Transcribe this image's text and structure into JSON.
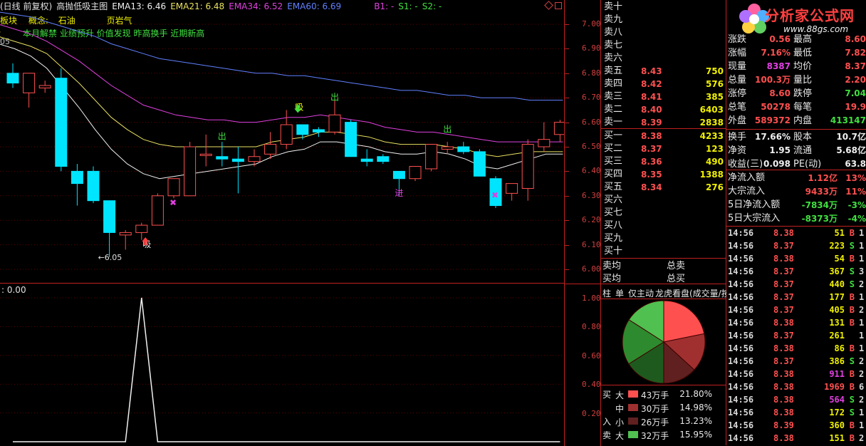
{
  "header": {
    "chart_mode": "(日线 前复权)",
    "indicator_name": "高抛低吸主图",
    "ema13": "EMA13: 6.46",
    "ema21": "EMA21: 6.48",
    "ema34": "EMA34: 6.52",
    "ema60": "EMA60: 6.69",
    "b1": "B1: -",
    "s1": "S1: -",
    "s2": "S2: -"
  },
  "concept": {
    "sector_label": "板块",
    "concept_label": "概念:",
    "concept_value": "石油",
    "extra": "页岩气",
    "tags": "本月解禁 业绩预升 价值发现 昨高换手 近期新高",
    "left_clip": "05"
  },
  "sub_chart": {
    "title": ": 0.00"
  },
  "price_axis": [
    "7.00",
    "6.90",
    "6.80",
    "6.70",
    "6.60",
    "6.50",
    "6.40",
    "6.30",
    "6.20",
    "6.10",
    "6.00"
  ],
  "sub_axis": [
    "1.00",
    "0.80",
    "0.60",
    "0.40",
    "0.20"
  ],
  "chart_data": {
    "type": "candlestick",
    "ylim": [
      5.95,
      7.05
    ],
    "candles": [
      {
        "o": 6.8,
        "h": 6.84,
        "l": 6.74,
        "c": 6.76
      },
      {
        "o": 6.72,
        "h": 6.78,
        "l": 6.66,
        "c": 6.8
      },
      {
        "o": 6.74,
        "h": 6.77,
        "l": 6.72,
        "c": 6.75
      },
      {
        "o": 6.78,
        "h": 6.82,
        "l": 6.4,
        "c": 6.42
      },
      {
        "o": 6.4,
        "h": 6.43,
        "l": 6.26,
        "c": 6.35
      },
      {
        "o": 6.4,
        "h": 6.42,
        "l": 6.27,
        "c": 6.28
      },
      {
        "o": 6.28,
        "h": 6.28,
        "l": 6.05,
        "c": 6.15
      },
      {
        "o": 6.14,
        "h": 6.16,
        "l": 6.08,
        "c": 6.15
      },
      {
        "o": 6.15,
        "h": 6.19,
        "l": 6.12,
        "c": 6.18
      },
      {
        "o": 6.18,
        "h": 6.31,
        "l": 6.18,
        "c": 6.3
      },
      {
        "o": 6.3,
        "h": 6.37,
        "l": 6.29,
        "c": 6.37
      },
      {
        "o": 6.3,
        "h": 6.52,
        "l": 6.3,
        "c": 6.5
      },
      {
        "o": 6.47,
        "h": 6.55,
        "l": 6.42,
        "c": 6.47
      },
      {
        "o": 6.46,
        "h": 6.52,
        "l": 6.42,
        "c": 6.45
      },
      {
        "o": 6.45,
        "h": 6.5,
        "l": 6.31,
        "c": 6.44
      },
      {
        "o": 6.44,
        "h": 6.49,
        "l": 6.42,
        "c": 6.46
      },
      {
        "o": 6.47,
        "h": 6.56,
        "l": 6.45,
        "c": 6.51
      },
      {
        "o": 6.51,
        "h": 6.65,
        "l": 6.49,
        "c": 6.59
      },
      {
        "o": 6.59,
        "h": 6.59,
        "l": 6.53,
        "c": 6.55
      },
      {
        "o": 6.57,
        "h": 6.58,
        "l": 6.54,
        "c": 6.56
      },
      {
        "o": 6.56,
        "h": 6.72,
        "l": 6.55,
        "c": 6.63
      },
      {
        "o": 6.6,
        "h": 6.61,
        "l": 6.46,
        "c": 6.46
      },
      {
        "o": 6.45,
        "h": 6.49,
        "l": 6.42,
        "c": 6.44
      },
      {
        "o": 6.46,
        "h": 6.47,
        "l": 6.43,
        "c": 6.44
      },
      {
        "o": 6.4,
        "h": 6.4,
        "l": 6.3,
        "c": 6.37
      },
      {
        "o": 6.37,
        "h": 6.42,
        "l": 6.36,
        "c": 6.42
      },
      {
        "o": 6.41,
        "h": 6.51,
        "l": 6.4,
        "c": 6.51
      },
      {
        "o": 6.49,
        "h": 6.52,
        "l": 6.47,
        "c": 6.5
      },
      {
        "o": 6.5,
        "h": 6.52,
        "l": 6.47,
        "c": 6.48
      },
      {
        "o": 6.48,
        "h": 6.49,
        "l": 6.38,
        "c": 6.38
      },
      {
        "o": 6.37,
        "h": 6.38,
        "l": 6.25,
        "c": 6.26
      },
      {
        "o": 6.31,
        "h": 6.35,
        "l": 6.28,
        "c": 6.35
      },
      {
        "o": 6.33,
        "h": 6.53,
        "l": 6.28,
        "c": 6.51
      },
      {
        "o": 6.5,
        "h": 6.6,
        "l": 6.48,
        "c": 6.53
      },
      {
        "o": 6.55,
        "h": 6.61,
        "l": 6.52,
        "c": 6.6
      }
    ],
    "ema_series": [
      {
        "name": "EMA13",
        "color": "#f0f0f0",
        "values": [
          6.92,
          6.9,
          6.87,
          6.82,
          6.74,
          6.66,
          6.57,
          6.49,
          6.43,
          6.39,
          6.37,
          6.38,
          6.39,
          6.4,
          6.41,
          6.42,
          6.43,
          6.46,
          6.48,
          6.49,
          6.52,
          6.52,
          6.51,
          6.5,
          6.48,
          6.47,
          6.47,
          6.48,
          6.47,
          6.45,
          6.42,
          6.41,
          6.43,
          6.45,
          6.47
        ]
      },
      {
        "name": "EMA21",
        "color": "#e8e060",
        "values": [
          6.95,
          6.93,
          6.91,
          6.88,
          6.82,
          6.76,
          6.69,
          6.62,
          6.57,
          6.53,
          6.51,
          6.5,
          6.5,
          6.5,
          6.5,
          6.5,
          6.5,
          6.52,
          6.53,
          6.54,
          6.56,
          6.56,
          6.55,
          6.54,
          6.52,
          6.51,
          6.51,
          6.51,
          6.5,
          6.49,
          6.47,
          6.46,
          6.47,
          6.48,
          6.48
        ]
      },
      {
        "name": "EMA34",
        "color": "#e040e0",
        "values": [
          7.0,
          6.98,
          6.96,
          6.93,
          6.89,
          6.85,
          6.8,
          6.75,
          6.71,
          6.67,
          6.65,
          6.63,
          6.62,
          6.61,
          6.61,
          6.6,
          6.6,
          6.61,
          6.62,
          6.62,
          6.63,
          6.62,
          6.61,
          6.6,
          6.58,
          6.57,
          6.56,
          6.56,
          6.55,
          6.54,
          6.53,
          6.52,
          6.52,
          6.52,
          6.52
        ]
      },
      {
        "name": "EMA60",
        "color": "#6080ff",
        "values": [
          7.05,
          7.04,
          7.03,
          7.01,
          6.99,
          6.97,
          6.95,
          6.92,
          6.9,
          6.88,
          6.86,
          6.85,
          6.84,
          6.83,
          6.82,
          6.81,
          6.8,
          6.8,
          6.79,
          6.79,
          6.78,
          6.77,
          6.76,
          6.75,
          6.74,
          6.73,
          6.73,
          6.72,
          6.71,
          6.71,
          6.7,
          6.7,
          6.7,
          6.69,
          6.69
        ]
      }
    ],
    "annotations": [
      {
        "index": 6,
        "text": "←6.05",
        "kind": "low",
        "value": 6.05
      },
      {
        "index": 7,
        "text": "吸",
        "kind": "buy"
      },
      {
        "index": 10,
        "text": "✖",
        "kind": "mark",
        "value": 6.26
      },
      {
        "index": 13,
        "text": "出",
        "kind": "sell",
        "value": 6.53
      },
      {
        "index": 17,
        "text": "吸",
        "kind": "buy",
        "value": 6.65
      },
      {
        "index": 20,
        "text": "出",
        "kind": "sell",
        "value": 6.69
      },
      {
        "index": 24,
        "text": "进",
        "kind": "enter",
        "value": 6.3
      },
      {
        "index": 27,
        "text": "出",
        "kind": "sell",
        "value": 6.56
      },
      {
        "index": 30,
        "text": "✖",
        "kind": "mark",
        "value": 6.29
      }
    ],
    "sub_series": {
      "name": "",
      "values": [
        0,
        0,
        0,
        0,
        0,
        0,
        0,
        0,
        1,
        0,
        0,
        0,
        0,
        0,
        0,
        0,
        0,
        0,
        0,
        0,
        0,
        0,
        0,
        0,
        0,
        0,
        0,
        0,
        0,
        0,
        0,
        0,
        0,
        0,
        0
      ],
      "ylim": [
        0,
        1.1
      ]
    }
  },
  "order_book": {
    "sell": [
      {
        "label": "卖十",
        "price": "",
        "vol": ""
      },
      {
        "label": "卖九",
        "price": "",
        "vol": ""
      },
      {
        "label": "卖八",
        "price": "",
        "vol": ""
      },
      {
        "label": "卖七",
        "price": "",
        "vol": ""
      },
      {
        "label": "卖六",
        "price": "",
        "vol": ""
      },
      {
        "label": "卖五",
        "price": "8.43",
        "vol": "750"
      },
      {
        "label": "卖四",
        "price": "8.42",
        "vol": "576"
      },
      {
        "label": "卖三",
        "price": "8.41",
        "vol": "385"
      },
      {
        "label": "卖二",
        "price": "8.40",
        "vol": "6403"
      },
      {
        "label": "卖一",
        "price": "8.39",
        "vol": "2838"
      }
    ],
    "buy": [
      {
        "label": "买一",
        "price": "8.38",
        "vol": "4233"
      },
      {
        "label": "买二",
        "price": "8.37",
        "vol": "123"
      },
      {
        "label": "买三",
        "price": "8.36",
        "vol": "490"
      },
      {
        "label": "买四",
        "price": "8.35",
        "vol": "1388"
      },
      {
        "label": "买五",
        "price": "8.34",
        "vol": "276"
      },
      {
        "label": "买六",
        "price": "",
        "vol": ""
      },
      {
        "label": "买七",
        "price": "",
        "vol": ""
      },
      {
        "label": "买八",
        "price": "",
        "vol": ""
      },
      {
        "label": "买九",
        "price": "",
        "vol": ""
      },
      {
        "label": "买十",
        "price": "",
        "vol": ""
      }
    ],
    "avg_sell": "卖均",
    "avg_buy": "买均",
    "total_sell": "总卖",
    "total_buy": "总买"
  },
  "tabs": [
    "柱",
    "单",
    "仅主动",
    "龙虎看盘(成交量/按"
  ],
  "distribution": {
    "buy_label": "买",
    "in_label": "入",
    "sell_label": "卖",
    "rows": [
      {
        "size": "大",
        "amount": "43万手",
        "pct": "21.80%",
        "color": "#ff5050",
        "value": 21.8
      },
      {
        "size": "中",
        "amount": "30万手",
        "pct": "14.98%",
        "color": "#a03030",
        "value": 14.98
      },
      {
        "size": "小",
        "amount": "26万手",
        "pct": "13.23%",
        "color": "#602020",
        "value": 13.23
      },
      {
        "size": "大",
        "amount": "32万手",
        "pct": "15.95%",
        "color": "#50c050",
        "value": 15.95
      }
    ],
    "pie": [
      {
        "value": 21.8,
        "color": "#ff5050"
      },
      {
        "value": 14.98,
        "color": "#a03030"
      },
      {
        "value": 13.23,
        "color": "#602020"
      },
      {
        "value": 16.06,
        "color": "#1e5a1e"
      },
      {
        "value": 17.98,
        "color": "#2e8a2e"
      },
      {
        "value": 15.95,
        "color": "#50c050"
      }
    ]
  },
  "banner": {
    "title": "分析家公式网",
    "url": "www.88gs.com"
  },
  "quote": [
    {
      "l1": "涨跌",
      "v1": "0.56",
      "l2": "最高",
      "v2": "8.60"
    },
    {
      "l1": "涨幅",
      "v1": "7.16%",
      "l2": "最低",
      "v2": "7.82"
    },
    {
      "l1": "现量",
      "v1": "8387",
      "l2": "均价",
      "v2": "8.37"
    },
    {
      "l1": "总量",
      "v1": "100.3万",
      "l2": "量比",
      "v2": "2.20"
    },
    {
      "l1": "涨停",
      "v1": "8.60",
      "l2": "跌停",
      "v2": "7.04"
    },
    {
      "l1": "总笔",
      "v1": "50278",
      "l2": "每笔",
      "v2": "19.9"
    },
    {
      "l1": "外盘",
      "v1": "589372",
      "l2": "内盘",
      "v2": "413147"
    },
    {
      "l1": "换手",
      "v1": "17.66%",
      "l2": "股本",
      "v2": "10.7亿"
    },
    {
      "l1": "净资",
      "v1": "1.95",
      "l2": "流通",
      "v2": "5.68亿"
    },
    {
      "l1": "收益(三)",
      "v1": "0.098",
      "l2": "PE(动)",
      "v2": "63.8"
    }
  ],
  "flows": [
    {
      "label": "净流入额",
      "value": "1.12亿",
      "pct": "13%",
      "color": "#ff5050"
    },
    {
      "label": "大宗流入",
      "value": "9433万",
      "pct": "11%",
      "color": "#ff5050"
    },
    {
      "label": "5日净流入额",
      "value": "-7834万",
      "pct": "-3%",
      "color": "#40e040"
    },
    {
      "label": "5日大宗流入",
      "value": "-8373万",
      "pct": "-4%",
      "color": "#40e040"
    }
  ],
  "ticks": [
    {
      "t": "14:56",
      "p": "8.38",
      "v": "51",
      "s": "B",
      "x": "1"
    },
    {
      "t": "14:56",
      "p": "8.37",
      "v": "223",
      "s": "S",
      "x": "1"
    },
    {
      "t": "14:56",
      "p": "8.38",
      "v": "54",
      "s": "B",
      "x": "1"
    },
    {
      "t": "14:56",
      "p": "8.37",
      "v": "367",
      "s": "S",
      "x": "3"
    },
    {
      "t": "14:56",
      "p": "8.37",
      "v": "440",
      "s": "S",
      "x": "2"
    },
    {
      "t": "14:56",
      "p": "8.37",
      "v": "177",
      "s": "B",
      "x": "1"
    },
    {
      "t": "14:56",
      "p": "8.37",
      "v": "405",
      "s": "B",
      "x": "2"
    },
    {
      "t": "14:56",
      "p": "8.38",
      "v": "131",
      "s": "B",
      "x": "1"
    },
    {
      "t": "14:56",
      "p": "8.37",
      "v": "261",
      "s": "",
      "x": "1"
    },
    {
      "t": "14:56",
      "p": "8.38",
      "v": "86",
      "s": "B",
      "x": "1"
    },
    {
      "t": "14:56",
      "p": "8.37",
      "v": "386",
      "s": "S",
      "x": "2"
    },
    {
      "t": "14:56",
      "p": "8.38",
      "v": "911",
      "s": "B",
      "x": "2"
    },
    {
      "t": "14:56",
      "p": "8.38",
      "v": "1969",
      "s": "B",
      "x": "6"
    },
    {
      "t": "14:56",
      "p": "8.38",
      "v": "564",
      "s": "S",
      "x": "2"
    },
    {
      "t": "14:56",
      "p": "8.38",
      "v": "172",
      "s": "S",
      "x": "1"
    },
    {
      "t": "14:56",
      "p": "8.39",
      "v": "360",
      "s": "B",
      "x": "1"
    },
    {
      "t": "14:56",
      "p": "8.38",
      "v": "151",
      "s": "B",
      "x": "2"
    }
  ],
  "colors": {
    "up": "#ff5050",
    "down": "#00e5ff",
    "grid": "#800000",
    "border": "#c02020"
  }
}
